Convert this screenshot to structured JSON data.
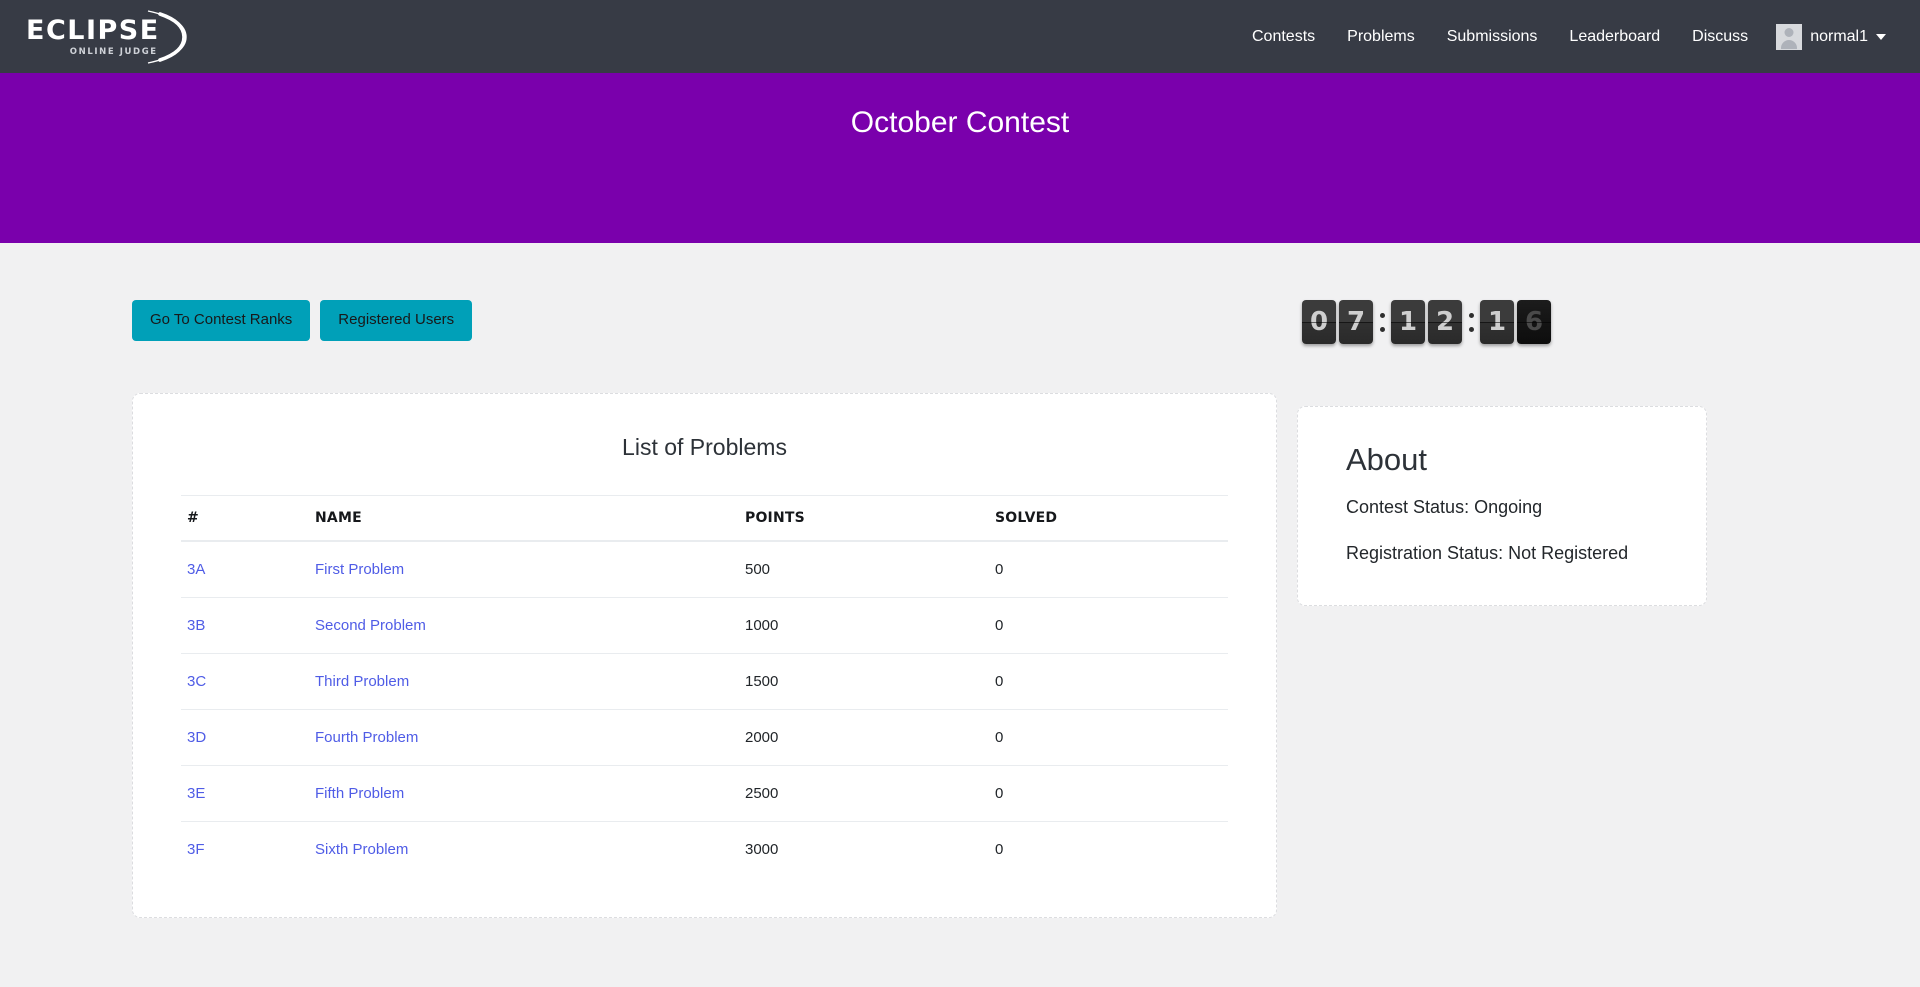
{
  "navbar": {
    "brand": {
      "name": "ECLIPSE",
      "tagline": "ONLINE JUDGE",
      "icon": "crescent-arc-icon"
    },
    "links": [
      {
        "label": "Contests"
      },
      {
        "label": "Problems"
      },
      {
        "label": "Submissions"
      },
      {
        "label": "Leaderboard"
      },
      {
        "label": "Discuss"
      }
    ],
    "user": {
      "name": "normal1",
      "avatar_icon": "user-avatar-icon",
      "caret_icon": "chevron-down-icon"
    }
  },
  "hero": {
    "title": "October Contest",
    "background": "#7a00ac"
  },
  "actions": {
    "ranks_label": "Go To Contest Ranks",
    "registered_label": "Registered Users",
    "accent": "#00a0b8"
  },
  "countdown": {
    "display": "07:12:16",
    "hours": [
      "0",
      "7"
    ],
    "minutes": [
      "1",
      "2"
    ],
    "seconds": [
      "1",
      "6"
    ],
    "flipping_digit": "6"
  },
  "problems_card": {
    "title": "List of Problems",
    "columns": [
      "#",
      "NAME",
      "POINTS",
      "SOLVED"
    ],
    "rows": [
      {
        "index": "3A",
        "name": "First Problem",
        "points": "500",
        "solved": "0"
      },
      {
        "index": "3B",
        "name": "Second Problem",
        "points": "1000",
        "solved": "0"
      },
      {
        "index": "3C",
        "name": "Third Problem",
        "points": "1500",
        "solved": "0"
      },
      {
        "index": "3D",
        "name": "Fourth Problem",
        "points": "2000",
        "solved": "0"
      },
      {
        "index": "3E",
        "name": "Fifth Problem",
        "points": "2500",
        "solved": "0"
      },
      {
        "index": "3F",
        "name": "Sixth Problem",
        "points": "3000",
        "solved": "0"
      }
    ],
    "link_color": "#4f5ce6"
  },
  "about_card": {
    "title": "About",
    "contest_status": "Contest Status: Ongoing",
    "registration_status": "Registration Status: Not Registered"
  }
}
